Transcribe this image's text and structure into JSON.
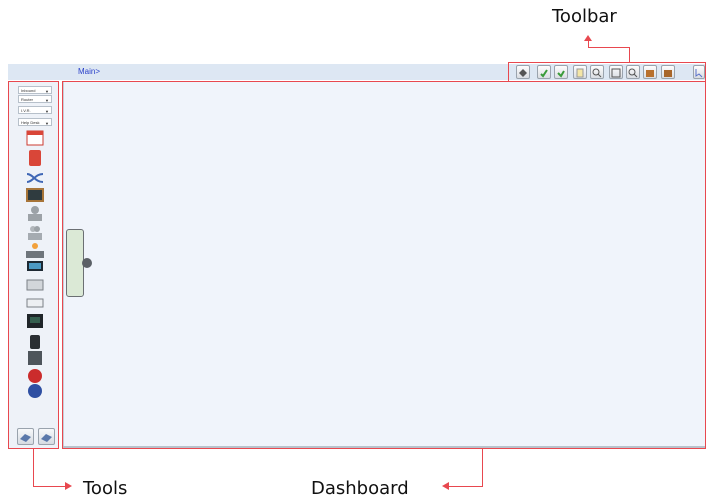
{
  "annotations": {
    "toolbar": "Toolbar",
    "tools": "Tools",
    "dashboard": "Dashboard"
  },
  "app": {
    "breadcrumb": "Main>",
    "tools_panel": {
      "dropdowns": [
        {
          "label": "Inbound",
          "arrow": "▼"
        },
        {
          "label": "Router",
          "arrow": "▼"
        },
        {
          "label": "I.V.R.",
          "arrow": "▼"
        },
        {
          "label": "Help Desk",
          "arrow": "▼"
        }
      ],
      "icons": [
        "calendar-icon",
        "phonebook-icon",
        "shuffle-icon",
        "chalkboard-icon",
        "user-icon",
        "user-group-icon",
        "agent-group-icon",
        "monitor-icon",
        "server-icon",
        "terminal-icon",
        "voicemail-icon",
        "desk-phone-icon",
        "hangup-icon",
        "redial-icon"
      ]
    },
    "toolbar_icons": [
      "move-icon",
      "save-icon",
      "edit-icon",
      "copy-icon",
      "zoom-in-icon",
      "fit-screen-icon",
      "zoom-out-icon",
      "package-icon",
      "deploy-icon",
      "select-icon"
    ],
    "bottom_buttons": [
      "import-icon",
      "export-icon"
    ],
    "colors": {
      "annotation": "#e8484f",
      "header": "#dde7f3",
      "dashboard": "#f0f4fb",
      "node": "#dbe9d6"
    }
  }
}
